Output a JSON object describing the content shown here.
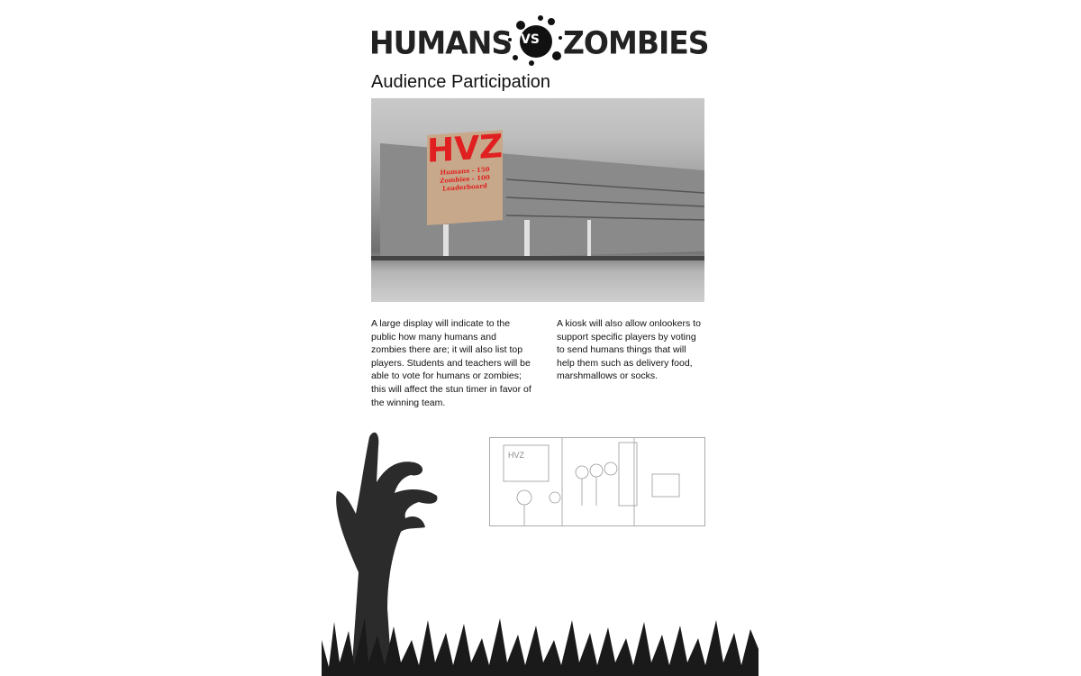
{
  "logo": {
    "left": "HUMANS",
    "vs": "VS",
    "right": "ZOMBIES"
  },
  "heading": "Audience Participation",
  "photo": {
    "sign": {
      "title": "HVZ",
      "line1": "Humans - 150",
      "line2": "Zombies - 100",
      "line3": "Leaderboard"
    }
  },
  "columns": [
    "A large display will indicate to the public how many humans and zombies there are; it will also list top players. Students and teachers will be able to vote for humans or zombies; this will affect the stun timer in favor of the winning team.",
    "A kiosk will also allow onlookers to support specific players by voting to send humans things that will help them such as delivery food, marshmallows or socks."
  ],
  "sketch": {
    "label": "HVZ"
  }
}
